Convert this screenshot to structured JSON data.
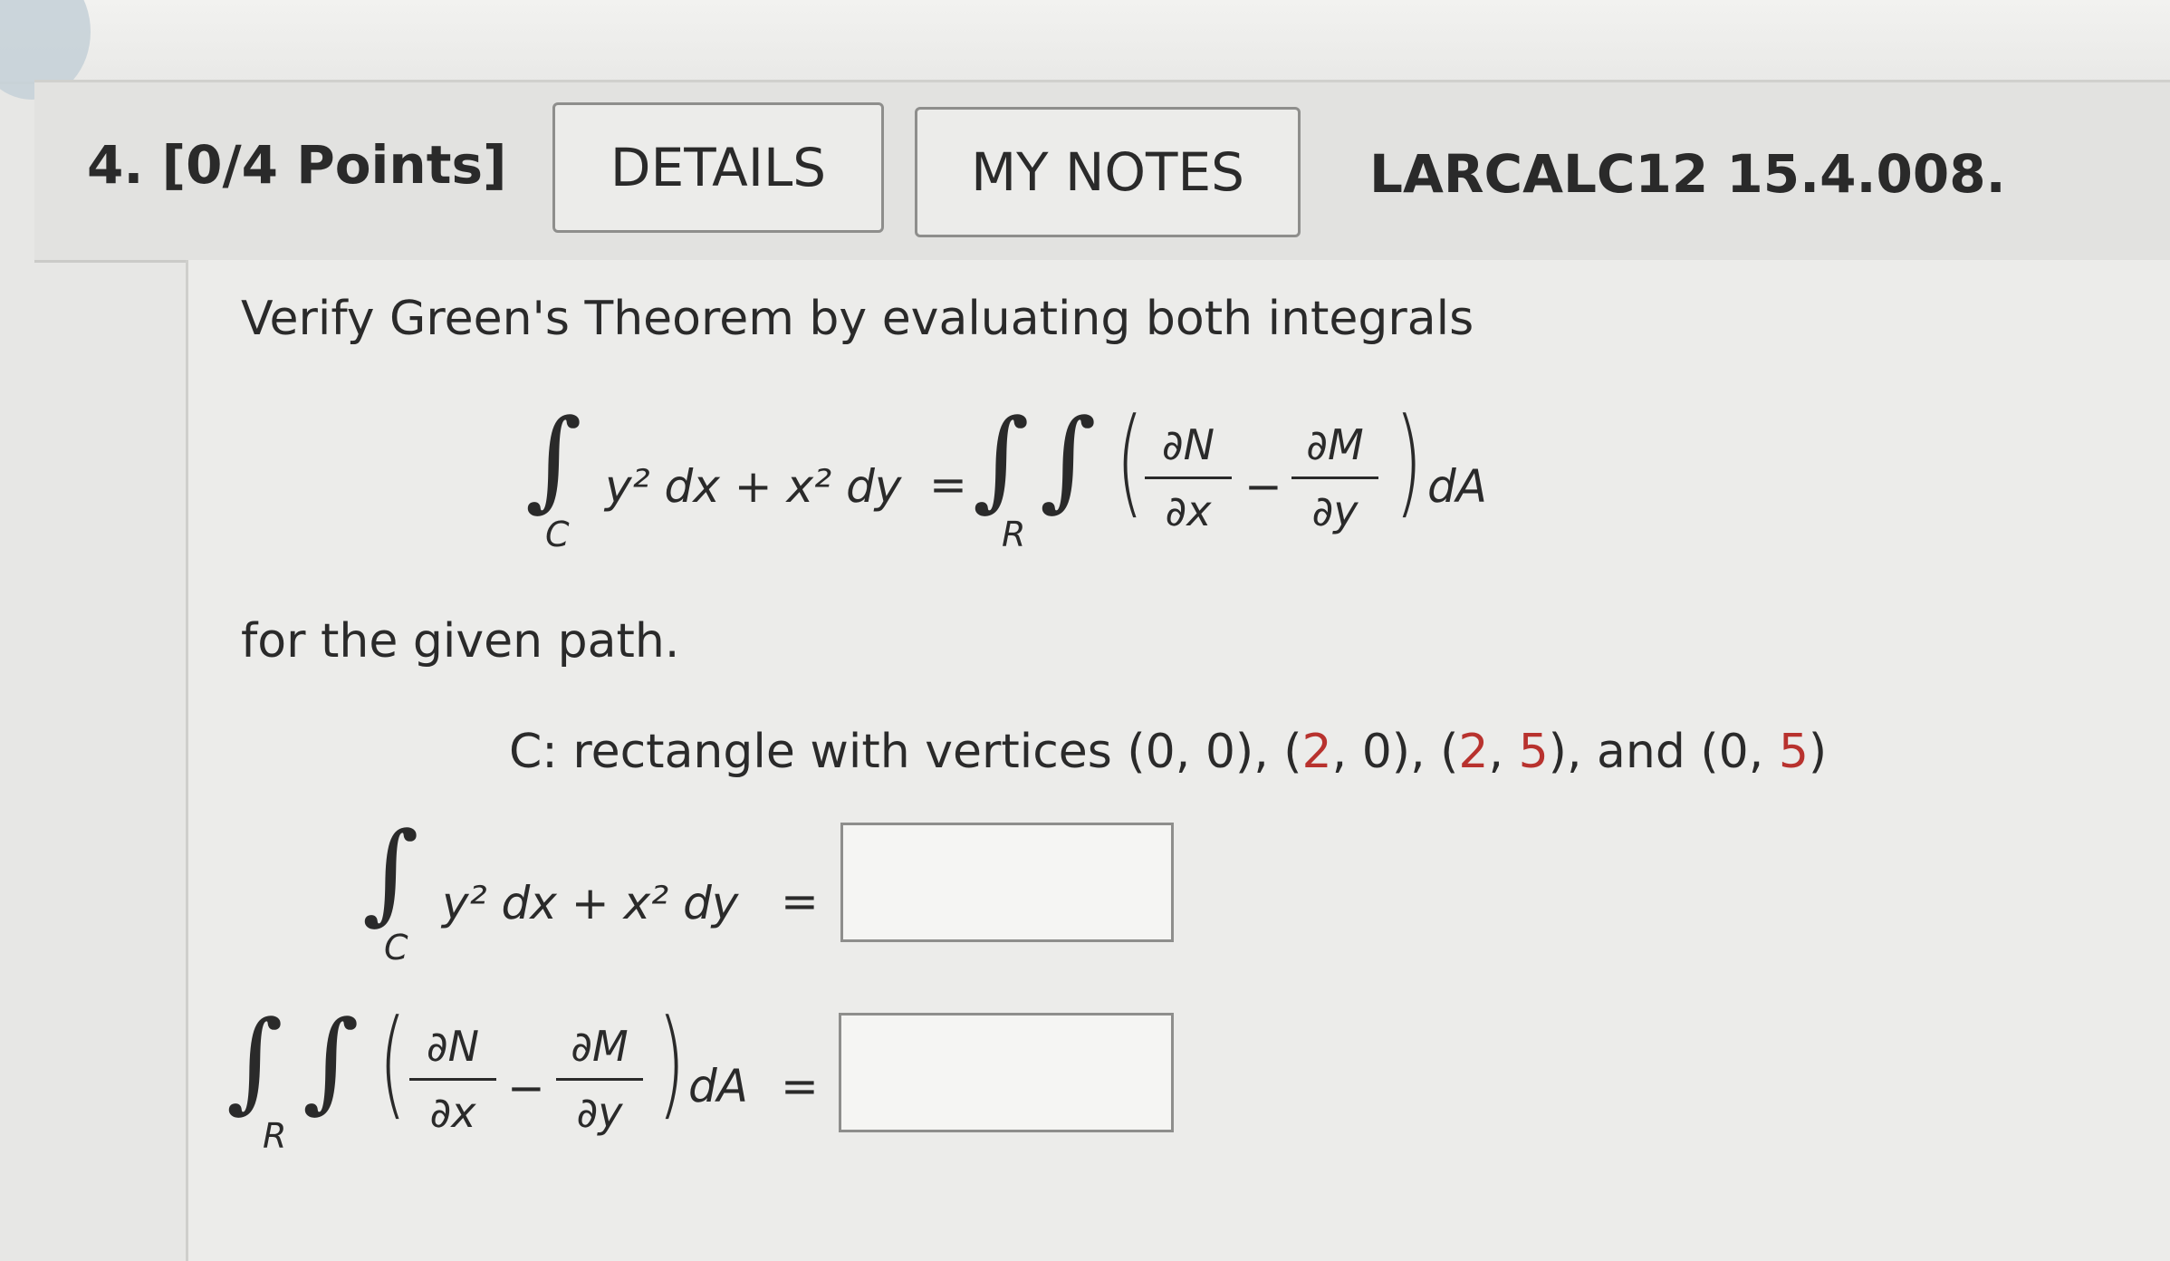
{
  "question": {
    "number": "4.",
    "points": "[0/4 Points]",
    "details_label": "DETAILS",
    "notes_label": "MY NOTES",
    "code": "LARCALC12 15.4.008."
  },
  "body": {
    "prompt": "Verify Green's Theorem by evaluating both integrals",
    "given": "for the given path.",
    "path_prefix": "C: rectangle with vertices (0, 0), (",
    "v2x": "2",
    "v2mid": ", 0), (",
    "v3x": "2",
    "v3mid": ", ",
    "v3y": "5",
    "v3end": "), and (0, ",
    "v4y": "5",
    "path_suffix": ")"
  },
  "math": {
    "line_integral": "y² dx + x² dy",
    "equals": "=",
    "sub_c": "C",
    "sub_r": "R",
    "dN": "∂N",
    "dx": "∂x",
    "dM": "∂M",
    "dy": "∂y",
    "minus": "−",
    "dA": "dA"
  },
  "answers": {
    "line_integral_value": "",
    "double_integral_value": ""
  }
}
